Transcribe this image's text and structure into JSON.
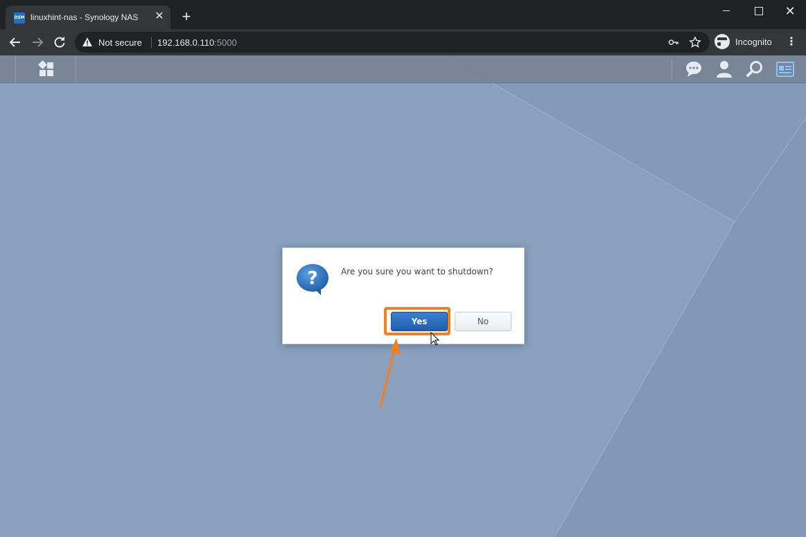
{
  "browser": {
    "tab_title": "linuxhint-nas - Synology NAS",
    "tab_favicon_text": "DSM",
    "security_label": "Not secure",
    "url_host": "192.168.0.110",
    "url_port": ":5000",
    "incognito_label": "Incognito"
  },
  "dsm": {
    "taskbar_icons": [
      "main-menu-icon",
      "message-icon",
      "user-icon",
      "search-icon",
      "widgets-icon"
    ]
  },
  "dialog": {
    "message": "Are you sure you want to shutdown?",
    "yes_label": "Yes",
    "no_label": "No",
    "icon": "question-icon"
  },
  "annotation": {
    "highlight_color": "#f47f20",
    "target": "yes-button"
  },
  "colors": {
    "desktop_bg": "#8aa0bd",
    "primary_button": "#2a6dc0"
  }
}
